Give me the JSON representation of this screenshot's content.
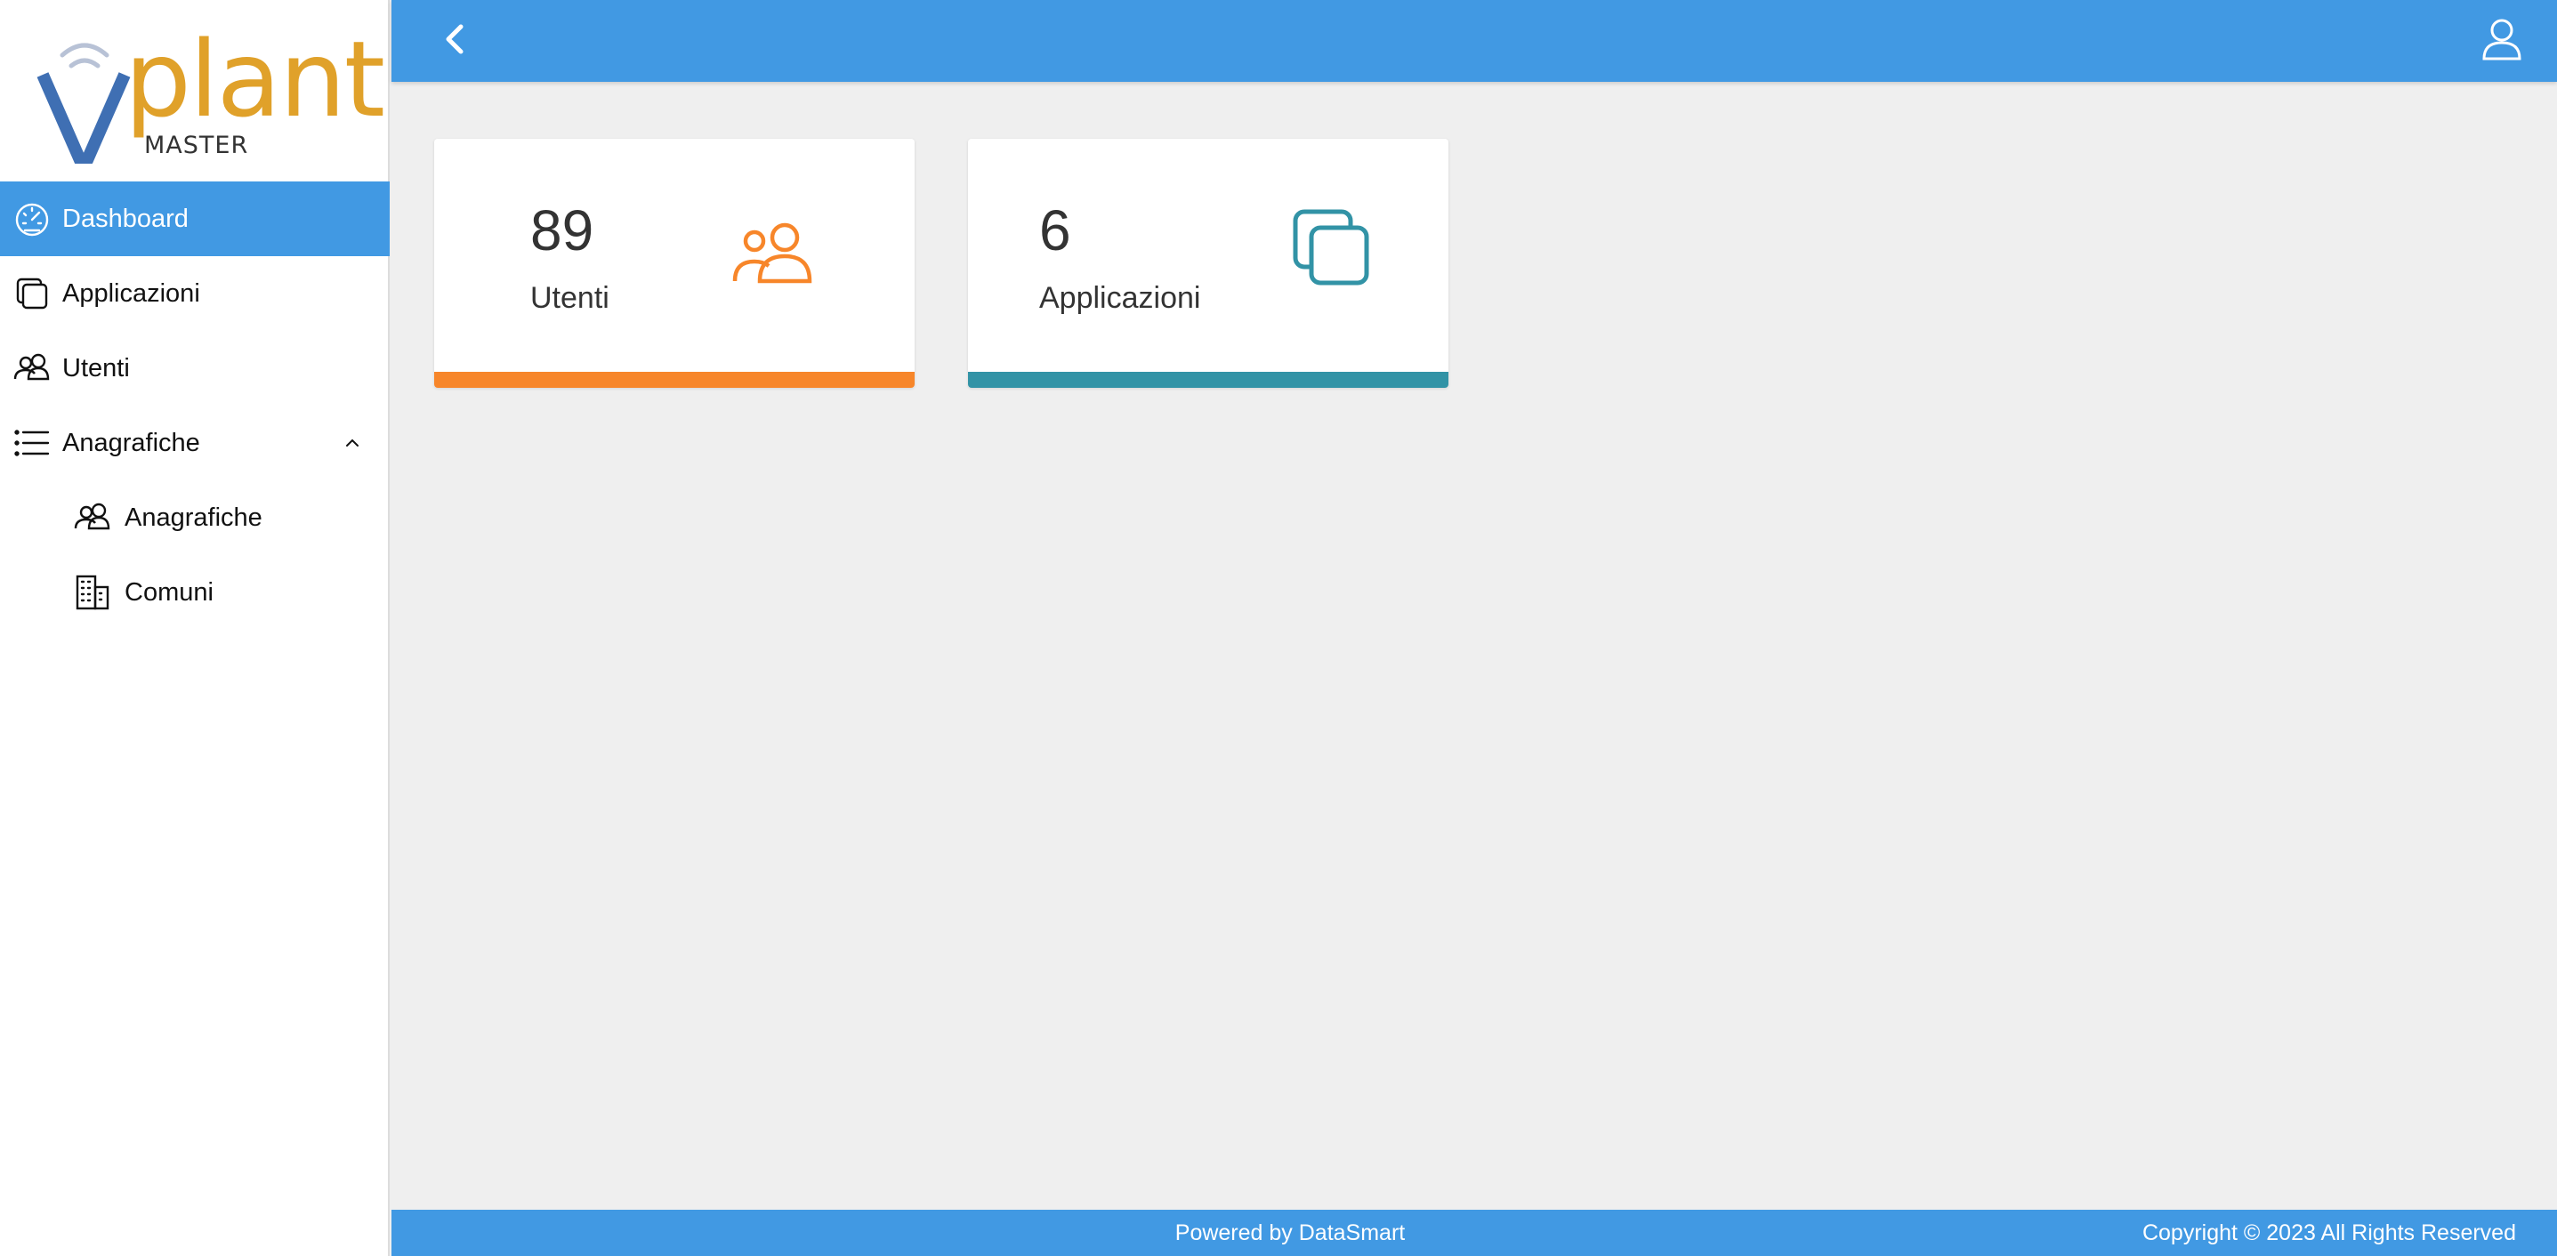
{
  "brand": {
    "word": "plant",
    "sub": "MASTER"
  },
  "sidebar": {
    "items": [
      {
        "label": "Dashboard",
        "icon": "speedometer-icon",
        "active": true
      },
      {
        "label": "Applicazioni",
        "icon": "copy-icon"
      },
      {
        "label": "Utenti",
        "icon": "users-icon"
      },
      {
        "label": "Anagrafiche",
        "icon": "list-icon",
        "expanded": true
      },
      {
        "label": "Anagrafiche",
        "icon": "users-icon",
        "sub": true
      },
      {
        "label": "Comuni",
        "icon": "building-icon",
        "sub": true
      }
    ]
  },
  "header": {
    "back_icon": "chevron-left-icon",
    "user_icon": "user-icon"
  },
  "cards": [
    {
      "count": "89",
      "label": "Utenti",
      "icon": "users-icon",
      "accent": "#f7862a"
    },
    {
      "count": "6",
      "label": "Applicazioni",
      "icon": "copy-icon",
      "accent": "#3293a6"
    }
  ],
  "footer": {
    "powered": "Powered by DataSmart",
    "copyright": "Copyright © 2023 All Rights Reserved"
  },
  "colors": {
    "primary": "#4199e3",
    "logo_gold": "#e0a12a",
    "logo_blue": "#3f6fb3"
  }
}
